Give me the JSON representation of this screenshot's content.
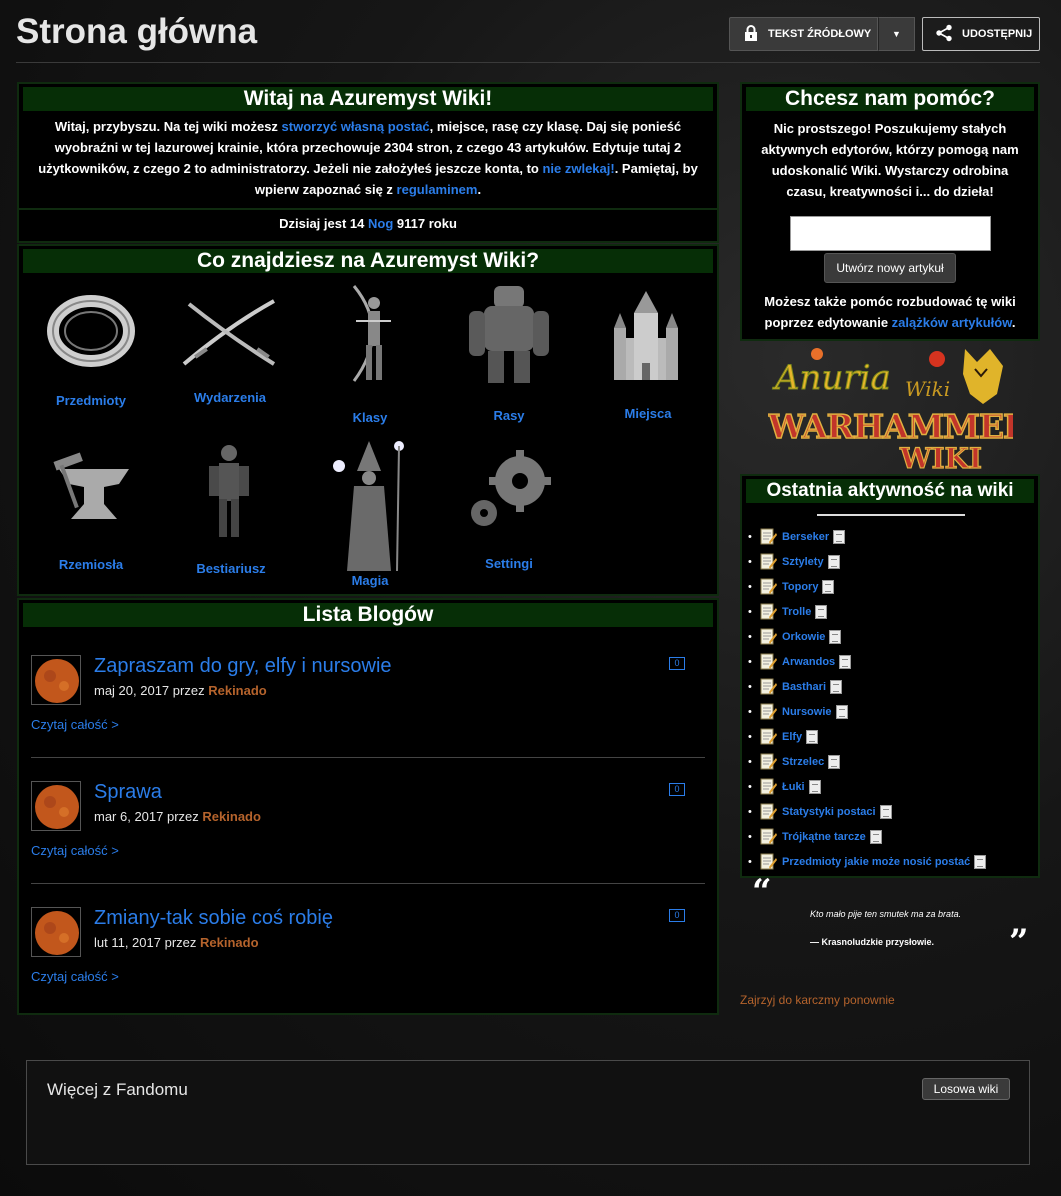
{
  "header": {
    "title": "Strona główna",
    "source_label": "TEKST ŹRÓDŁOWY",
    "share_label": "UDOSTĘPNIJ"
  },
  "welcome": {
    "title": "Witaj na Azuremyst Wiki!",
    "p1": "Witaj, przybyszu. Na tej wiki możesz ",
    "link_create": "stworzyć własną postać",
    "p2": ", miejsce, rasę czy klasę. Daj się ponieść wyobraźni w tej lazurowej krainie, która przechowuje 2304 stron, z czego 43 artykułów. Edytuje tutaj 2 użytkowników, z czego 2 to administratorzy. Jeżeli nie założyłeś jeszcze konta, to ",
    "link_dont_wait": "nie zwlekaj!",
    "p3": ". Pamiętaj, by wpierw zapoznać się z ",
    "link_rules": "regulaminem",
    "p4": ".",
    "date_prefix": "Dzisiaj jest 14 ",
    "date_month": "Nog",
    "date_suffix": " 9117 roku"
  },
  "categories": {
    "title": "Co znajdziesz na Azuremyst Wiki?",
    "items": [
      "Przedmioty",
      "Wydarzenia",
      "Klasy",
      "Rasy",
      "Miejsca",
      "Rzemiosła",
      "Bestiariusz",
      "Magia",
      "Settingi"
    ]
  },
  "blogs": {
    "title": "Lista Blogów",
    "read_more": "Czytaj całość >",
    "by": "przez",
    "items": [
      {
        "title": "Zapraszam do gry, elfy i nursowie",
        "date": "maj 20, 2017",
        "author": "Rekinado",
        "comments": "0"
      },
      {
        "title": "Sprawa",
        "date": "mar 6, 2017",
        "author": "Rekinado",
        "comments": "0"
      },
      {
        "title": "Zmiany-tak sobie coś robię",
        "date": "lut 11, 2017",
        "author": "Rekinado",
        "comments": "0"
      }
    ]
  },
  "help": {
    "title": "Chcesz nam pomóc?",
    "text": "Nic prostszego! Poszukujemy stałych aktywnych edytorów, którzy pomogą nam udoskonalić Wiki. Wystarczy odrobina czasu, kreatywności i... do dzieła!",
    "button": "Utwórz nowy artykuł",
    "text2": "Możesz także pomóc rozbudować tę wiki poprzez edytowanie ",
    "link_stubs": "zalążków artykułów",
    "text2_end": "."
  },
  "partners": {
    "anuria": "Anuria Wiki",
    "warhammer": "WARHAMMER",
    "warhammer_sub": "WIKI"
  },
  "activity": {
    "title": "Ostatnia aktywność na wiki",
    "items": [
      "Berseker",
      "Sztylety",
      "Topory",
      "Trolle",
      "Orkowie",
      "Arwandos",
      "Basthari",
      "Nursowie",
      "Elfy",
      "Strzelec",
      "Łuki",
      "Statystyki postaci",
      "Trójkątne tarcze",
      "Przedmioty jakie może nosić postać"
    ]
  },
  "quote": {
    "open": "“",
    "close": "”",
    "text": "Kto mało pije ten smutek ma za brata.",
    "author": "— Krasnoludzkie przysłowie."
  },
  "karma": "Zajrzyj do karczmy ponownie",
  "fandom": {
    "title": "Więcej z Fandomu",
    "random": "Losowa wiki"
  },
  "colors": {
    "link": "#2b7de9",
    "author": "#b5632c",
    "box_header": "#062e06",
    "box_border": "#0f2b0f"
  }
}
